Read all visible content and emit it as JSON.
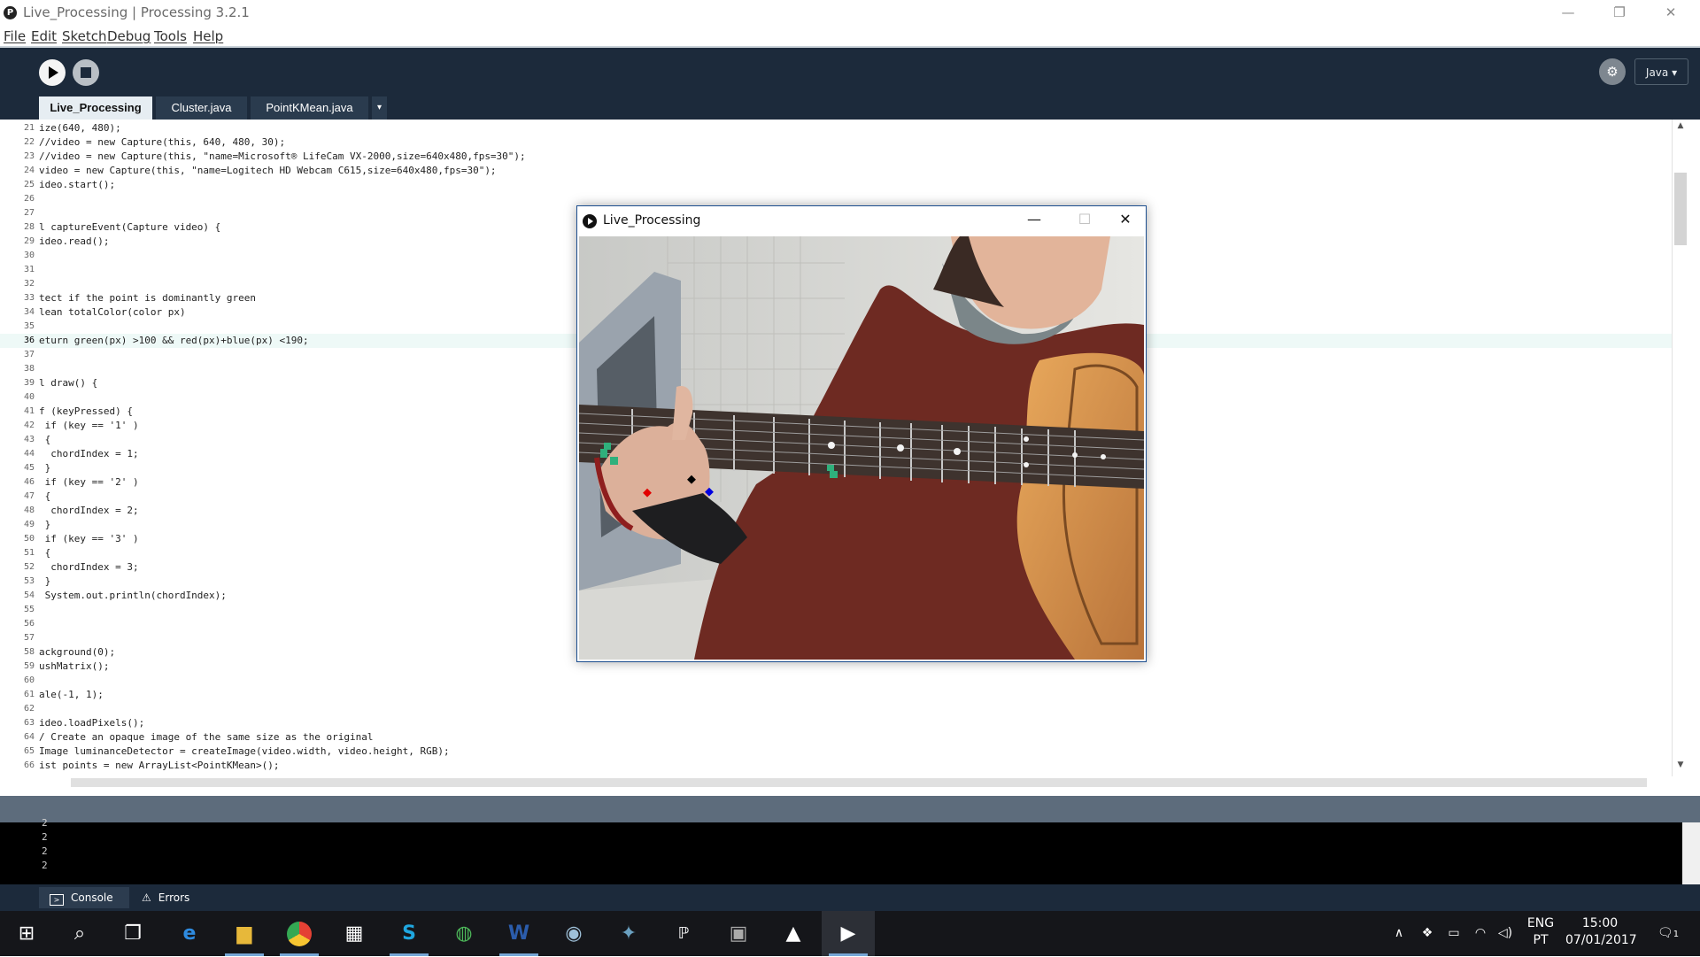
{
  "window": {
    "title": "Live_Processing | Processing 3.2.1",
    "minimize": "—",
    "restore": "❐",
    "close": "✕",
    "app_icon": "P"
  },
  "menu": [
    "File",
    "Edit",
    "Sketch",
    "Debug",
    "Tools",
    "Help"
  ],
  "toolbar": {
    "debug_icon_glyph": "⚙",
    "mode_label": "Java ▾"
  },
  "tabs": [
    {
      "label": "Live_Processing"
    },
    {
      "label": "Cluster.java"
    },
    {
      "label": "PointKMean.java"
    }
  ],
  "tab_menu_glyph": "▾",
  "editor": {
    "current_line": 36,
    "lines": [
      {
        "num": "21",
        "code": "ize(640, 480);"
      },
      {
        "num": "22",
        "code": "//video = new Capture(this, 640, 480, 30);"
      },
      {
        "num": "23",
        "code": "//video = new Capture(this, \"name=Microsoft® LifeCam VX-2000,size=640x480,fps=30\");"
      },
      {
        "num": "24",
        "code": "video = new Capture(this, \"name=Logitech HD Webcam C615,size=640x480,fps=30\");"
      },
      {
        "num": "25",
        "code": "ideo.start();"
      },
      {
        "num": "26",
        "code": ""
      },
      {
        "num": "27",
        "code": ""
      },
      {
        "num": "28",
        "code": "l captureEvent(Capture video) {"
      },
      {
        "num": "29",
        "code": "ideo.read();"
      },
      {
        "num": "30",
        "code": ""
      },
      {
        "num": "31",
        "code": ""
      },
      {
        "num": "32",
        "code": ""
      },
      {
        "num": "33",
        "code": "tect if the point is dominantly green"
      },
      {
        "num": "34",
        "code": "lean totalColor(color px)"
      },
      {
        "num": "35",
        "code": ""
      },
      {
        "num": "36",
        "code": "eturn green(px) >100 && red(px)+blue(px) <190;"
      },
      {
        "num": "37",
        "code": ""
      },
      {
        "num": "38",
        "code": ""
      },
      {
        "num": "39",
        "code": "l draw() {"
      },
      {
        "num": "40",
        "code": ""
      },
      {
        "num": "41",
        "code": "f (keyPressed) {"
      },
      {
        "num": "42",
        "code": " if (key == '1' )"
      },
      {
        "num": "43",
        "code": " {"
      },
      {
        "num": "44",
        "code": "  chordIndex = 1;"
      },
      {
        "num": "45",
        "code": " }"
      },
      {
        "num": "46",
        "code": " if (key == '2' )"
      },
      {
        "num": "47",
        "code": " {"
      },
      {
        "num": "48",
        "code": "  chordIndex = 2;"
      },
      {
        "num": "49",
        "code": " }"
      },
      {
        "num": "50",
        "code": " if (key == '3' )"
      },
      {
        "num": "51",
        "code": " {"
      },
      {
        "num": "52",
        "code": "  chordIndex = 3;"
      },
      {
        "num": "53",
        "code": " }"
      },
      {
        "num": "54",
        "code": " System.out.println(chordIndex);"
      },
      {
        "num": "55",
        "code": ""
      },
      {
        "num": "56",
        "code": ""
      },
      {
        "num": "57",
        "code": ""
      },
      {
        "num": "58",
        "code": "ackground(0);"
      },
      {
        "num": "59",
        "code": "ushMatrix();"
      },
      {
        "num": "60",
        "code": ""
      },
      {
        "num": "61",
        "code": "ale(-1, 1);"
      },
      {
        "num": "62",
        "code": ""
      },
      {
        "num": "63",
        "code": "ideo.loadPixels();"
      },
      {
        "num": "64",
        "code": "/ Create an opaque image of the same size as the original"
      },
      {
        "num": "65",
        "code": "Image luminanceDetector = createImage(video.width, video.height, RGB);"
      },
      {
        "num": "66",
        "code": "ist points = new ArrayList<PointKMean>();"
      }
    ]
  },
  "console": {
    "lines": [
      "2",
      "2",
      "2",
      "2"
    ]
  },
  "status_tabs": [
    {
      "label": "Console",
      "icon": "console-icon"
    },
    {
      "label": "Errors",
      "icon": "warning-icon"
    }
  ],
  "video_window": {
    "title": "Live_Processing",
    "minimize": "—",
    "maximize": "☐",
    "close": "✕"
  },
  "taskbar": {
    "apps": [
      "windows-icon",
      "search-icon",
      "task-view-icon",
      "edge-icon",
      "file-explorer-icon",
      "chrome-icon",
      "store-icon",
      "skype-icon",
      "globe-icon",
      "word-icon",
      "steam-icon",
      "game-icon",
      "processing-icon",
      "package-icon",
      "photos-icon",
      "processing-running-icon"
    ],
    "lang_top": "ENG",
    "lang_bottom": "PT",
    "time": "15:00",
    "date": "07/01/2017",
    "notification_count": "1"
  },
  "colors": {
    "toolbar_bg": "#1c2a3b",
    "keyword": "#33997e",
    "function": "#006699",
    "string": "#7d4793",
    "type": "#e2661a"
  }
}
